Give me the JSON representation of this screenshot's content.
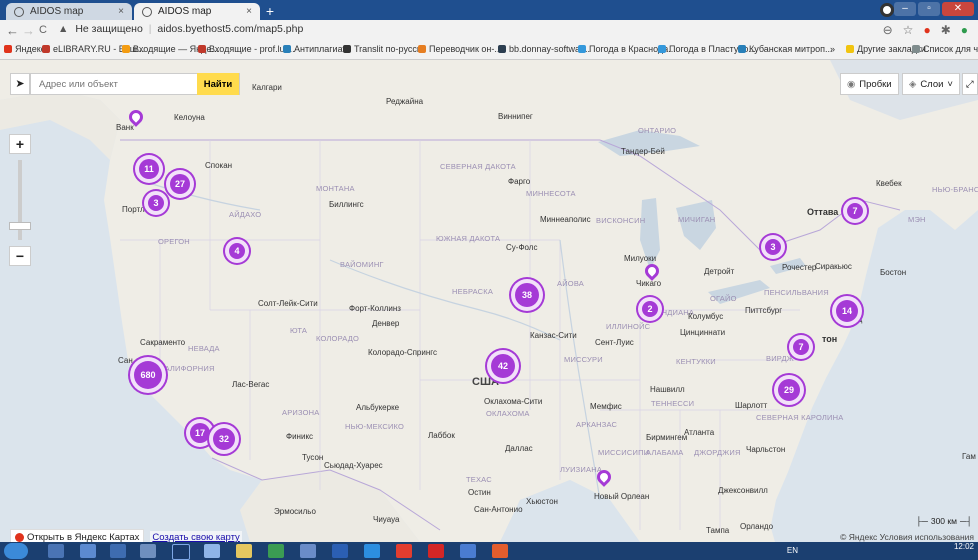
{
  "browser": {
    "tabs": [
      {
        "title": "AIDOS map",
        "close": "×"
      },
      {
        "title": "AIDOS map",
        "close": "×"
      }
    ],
    "new_tab": "+",
    "address": {
      "security": "Не защищено",
      "separator": "|",
      "url": "aidos.byethost5.com/map5.php"
    },
    "nav": {
      "back": "←",
      "forward": "→",
      "reload": "C"
    },
    "bookmarks": [
      {
        "label": "Яндекс",
        "color": "#e0331c"
      },
      {
        "label": "eLIBRARY.RU - Ваш...",
        "color": "#c0392b"
      },
      {
        "label": "Входящие — Янде...",
        "color": "#f39c12"
      },
      {
        "label": "Входящие - prof.lut...",
        "color": "#c0392b"
      },
      {
        "label": "Антиплагиат",
        "color": "#2980b9"
      },
      {
        "label": "Translit по-русски",
        "color": "#333333"
      },
      {
        "label": "Переводчик он-...",
        "color": "#e67e22"
      },
      {
        "label": "bb.donnay-softwar...",
        "color": "#2c3e50"
      },
      {
        "label": "Погода в Краснода...",
        "color": "#3498db"
      },
      {
        "label": "Погода в Пластуно...",
        "color": "#3498db"
      },
      {
        "label": "Кубанская митроп...",
        "color": "#2980b9"
      },
      {
        "label": "»",
        "color": ""
      },
      {
        "label": "Другие закладки",
        "color": "#f1c40f"
      },
      {
        "label": "Список для чтения",
        "color": "#7f8c8d"
      }
    ]
  },
  "map": {
    "search": {
      "placeholder": "Адрес или объект",
      "button": "Найти"
    },
    "controls": {
      "zoom_in": "+",
      "zoom_out": "−",
      "traffic": "Пробки",
      "layers": "Слои"
    },
    "open_in_yandex": "Открыть в Яндекс Картах",
    "create_map": "Создать свою карту",
    "scale": "300 км",
    "copyright": "© Яндекс Условия использования",
    "clusters": [
      {
        "count": "11",
        "color": "#a53ad6"
      },
      {
        "count": "27",
        "color": "#a53ad6"
      },
      {
        "count": "3",
        "color": "#a53ad6"
      },
      {
        "count": "4",
        "color": "#a53ad6"
      },
      {
        "count": "680",
        "color": "#a53ad6"
      },
      {
        "count": "17",
        "color": "#a53ad6"
      },
      {
        "count": "32",
        "color": "#a53ad6"
      },
      {
        "count": "38",
        "color": "#a53ad6"
      },
      {
        "count": "42",
        "color": "#a53ad6"
      },
      {
        "count": "2",
        "color": "#a53ad6"
      },
      {
        "count": "3",
        "color": "#a53ad6"
      },
      {
        "count": "7",
        "color": "#a53ad6"
      },
      {
        "count": "14",
        "color": "#a53ad6"
      },
      {
        "count": "7",
        "color": "#a53ad6"
      },
      {
        "count": "29",
        "color": "#a53ad6"
      }
    ],
    "labels": {
      "calgary": "Калгари",
      "regina": "Реджайна",
      "winnipeg": "Виннипег",
      "ontario": "ОНТАРИО",
      "kelowna": "Келоуна",
      "vancouver": "Ванк",
      "thunderbay": "Тандер-Бей",
      "quebec": "Квебек",
      "ottawa": "Оттава",
      "maine": "МЭН",
      "newbrunswick": "НЬЮ-БРАНСУ",
      "spokane": "Спокан",
      "portland": "Портл",
      "oregon": "ОРЕГОН",
      "idaho": "АЙДАХО",
      "montana": "МОНТАНА",
      "billings": "Биллингс",
      "northdakota": "СЕВЕРНАЯ ДАКОТА",
      "fargo": "Фарго",
      "minnesota": "МИННЕСОТА",
      "minneapolis": "Миннеаполис",
      "wisconsin": "ВИСКОНСИН",
      "michigan": "МИЧИГАН",
      "southdakota": "ЮЖНАЯ ДАКОТА",
      "siouxfalls": "Су-Фолс",
      "wyoming": "ВАЙОМИНГ",
      "milwaukee": "Милуоки",
      "detroit": "Детройт",
      "rochester": "Рочестер",
      "syracuse": "Сиракьюс",
      "boston": "Бостон",
      "chicago": "Чикаго",
      "iowa": "АЙОВА",
      "nebraska": "НЕБРАСКА",
      "saltlake": "Солт-Лейк-Сити",
      "fortcollins": "Форт-Коллинз",
      "denver": "Денвер",
      "colorado": "КОЛОРАДО",
      "coloradosprings": "Колорадо-Спрингс",
      "utah": "ЮТА",
      "nevada": "НЕВАДА",
      "sacramento": "Сакраменто",
      "california": "КАЛИФОРНИЯ",
      "lasvegas": "Лас-Вегас",
      "kansascity": "Канзас-Сити",
      "stlouis": "Сент-Луис",
      "illinois": "ИЛЛИНОЙС",
      "indiana": "ИНДИАНА",
      "ohio": "ОГАЙО",
      "columbus": "Колумбус",
      "pittsburgh": "Питтсбург",
      "pennsylvania": "ПЕНСИЛЬВАНИЯ",
      "philadelphia": "Филад",
      "cincinnati": "Цинциннати",
      "kentucky": "КЕНТУККИ",
      "missouri": "МИССУРИ",
      "virginia": "ВИРДЖ",
      "washington": "тон",
      "nashville": "Нашвилл",
      "tennessee": "ТЕННЕССИ",
      "charlotte": "Шарлотт",
      "southcarolina": "СЕВЕРНАЯ КАРОЛИНА",
      "atlanta": "Атланта",
      "birmingham": "Бирмингем",
      "charleston": "Чарльстон",
      "memphis": "Мемфис",
      "arkansas": "АРКАНЗАС",
      "oklahomacity": "Оклахома-Сити",
      "oklahoma": "ОКЛАХОМА",
      "usa": "США",
      "albuquerque": "Альбукерке",
      "arizona": "АРИЗОНА",
      "newmexico": "НЬЮ-МЕКСИКО",
      "phoenix": "Финикс",
      "lubbock": "Лаббок",
      "tucson": "Тусон",
      "ciudad": "Сьюдад-Хуарес",
      "dallas": "Даллас",
      "texas": "ТЕХАС",
      "austin": "Остин",
      "houston": "Хьюстон",
      "sanantonio": "Сан-Антонио",
      "louisiana": "ЛУИЗИАНА",
      "neworleans": "Новый Орлеан",
      "mississippi": "МИССИСИПИ",
      "alabama": "АЛАБАМА",
      "georgia": "ДЖОРДЖИЯ",
      "jacksonville": "Джексонвилл",
      "tampa": "Тампа",
      "orlando": "Орландо",
      "hermosillo": "Эрмосильо",
      "chihuahua": "Чиуауа",
      "san": "Сан",
      "gam": "Гам"
    }
  },
  "taskbar": {
    "lang": "EN",
    "time": "12:02"
  }
}
